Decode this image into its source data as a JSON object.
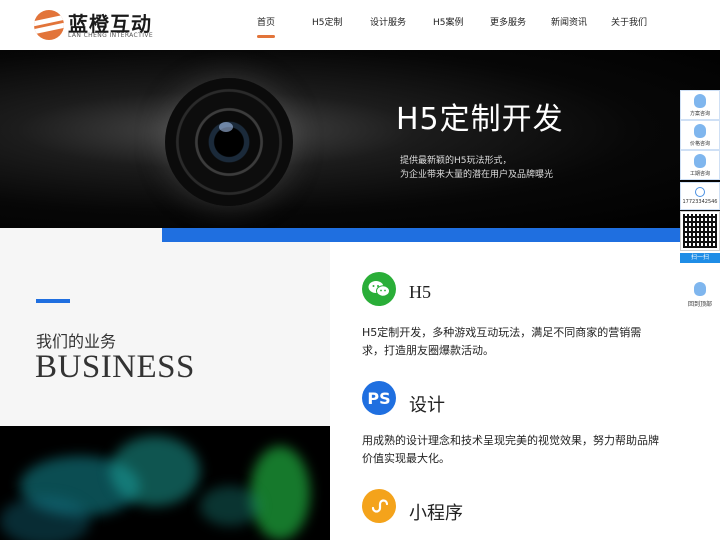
{
  "header": {
    "logo_cn": "蓝橙互动",
    "logo_en": "LAN CHENG INTERACTIVE",
    "nav": [
      {
        "label": "首页",
        "active": true
      },
      {
        "label": "H5定制"
      },
      {
        "label": "设计服务"
      },
      {
        "label": "H5案例"
      },
      {
        "label": "更多服务"
      },
      {
        "label": "新闻资讯"
      },
      {
        "label": "关于我们"
      }
    ]
  },
  "banner": {
    "title": "H5定制开发",
    "subtitle_line1": "提供最新颖的H5玩法形式，",
    "subtitle_line2": "为企业带来大量的潜在用户及品牌曝光"
  },
  "business": {
    "title_cn": "我们的业务",
    "title_en": "BUSINESS"
  },
  "services": [
    {
      "icon": "wechat-icon",
      "title": "H5",
      "color": "#2aae38",
      "desc": "H5定制开发，多种游戏互动玩法，满足不同商家的营销需求，打造朋友圈爆款活动。"
    },
    {
      "icon": "ps-icon",
      "glyph": "PS",
      "title": "设计",
      "color": "#1f6fe0",
      "desc": "用成熟的设计理念和技术呈现完美的视觉效果，努力帮助品牌价值实现最大化。"
    },
    {
      "icon": "miniprogram-icon",
      "title": "小程序",
      "color": "#f4a31b",
      "desc": ""
    }
  ],
  "floatbar": {
    "items": [
      "方案咨询",
      "价格咨询",
      "工期咨询"
    ],
    "phone": "17723342546",
    "scan": "扫一扫",
    "top": "回到顶部"
  },
  "colors": {
    "accent": "#e2743a",
    "brand_blue": "#1f6fe0"
  }
}
